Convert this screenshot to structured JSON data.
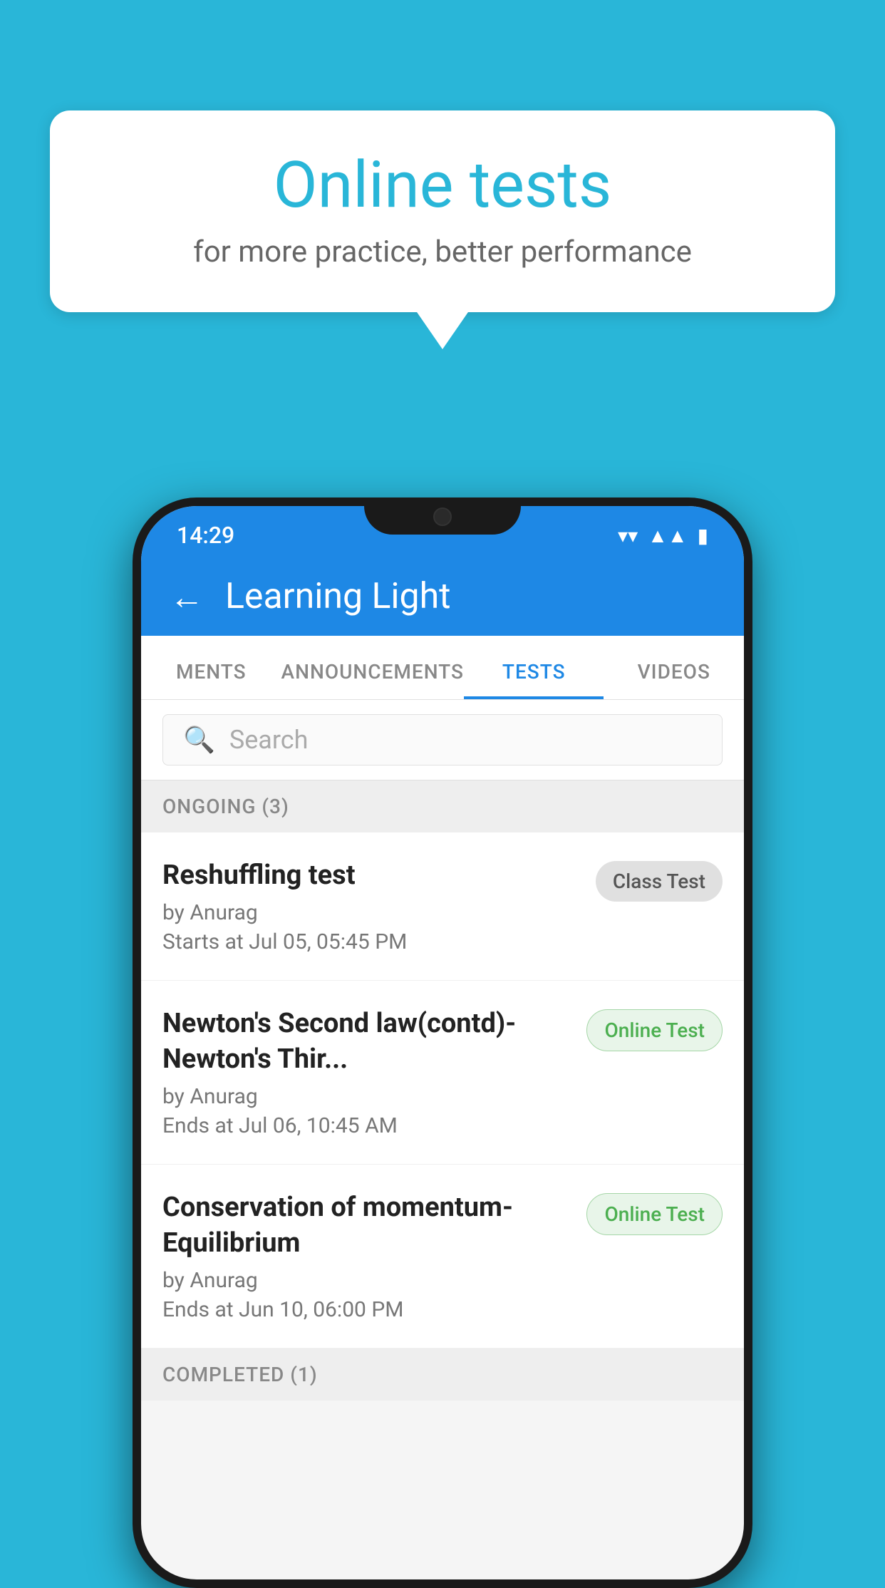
{
  "background_color": "#29b6d8",
  "bubble": {
    "title": "Online tests",
    "subtitle": "for more practice, better performance"
  },
  "phone": {
    "status_bar": {
      "time": "14:29",
      "icons": [
        "wifi",
        "signal",
        "battery"
      ]
    },
    "header": {
      "title": "Learning Light",
      "back_label": "←"
    },
    "tabs": [
      {
        "label": "MENTS",
        "active": false
      },
      {
        "label": "ANNOUNCEMENTS",
        "active": false
      },
      {
        "label": "TESTS",
        "active": true
      },
      {
        "label": "VIDEOS",
        "active": false
      }
    ],
    "search": {
      "placeholder": "Search"
    },
    "sections": [
      {
        "label": "ONGOING (3)",
        "items": [
          {
            "name": "Reshuffling test",
            "author": "by Anurag",
            "date": "Starts at  Jul 05, 05:45 PM",
            "badge": "Class Test",
            "badge_type": "class"
          },
          {
            "name": "Newton's Second law(contd)-Newton's Thir...",
            "author": "by Anurag",
            "date": "Ends at  Jul 06, 10:45 AM",
            "badge": "Online Test",
            "badge_type": "online"
          },
          {
            "name": "Conservation of momentum-Equilibrium",
            "author": "by Anurag",
            "date": "Ends at  Jun 10, 06:00 PM",
            "badge": "Online Test",
            "badge_type": "online"
          }
        ]
      },
      {
        "label": "COMPLETED (1)",
        "items": []
      }
    ]
  }
}
